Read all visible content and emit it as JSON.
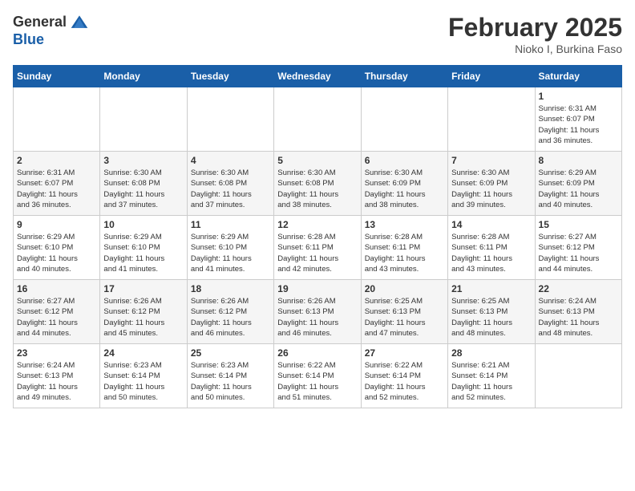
{
  "header": {
    "logo_general": "General",
    "logo_blue": "Blue",
    "month_title": "February 2025",
    "location": "Nioko I, Burkina Faso"
  },
  "days_of_week": [
    "Sunday",
    "Monday",
    "Tuesday",
    "Wednesday",
    "Thursday",
    "Friday",
    "Saturday"
  ],
  "weeks": [
    [
      {
        "day": "",
        "info": ""
      },
      {
        "day": "",
        "info": ""
      },
      {
        "day": "",
        "info": ""
      },
      {
        "day": "",
        "info": ""
      },
      {
        "day": "",
        "info": ""
      },
      {
        "day": "",
        "info": ""
      },
      {
        "day": "1",
        "info": "Sunrise: 6:31 AM\nSunset: 6:07 PM\nDaylight: 11 hours\nand 36 minutes."
      }
    ],
    [
      {
        "day": "2",
        "info": "Sunrise: 6:31 AM\nSunset: 6:07 PM\nDaylight: 11 hours\nand 36 minutes."
      },
      {
        "day": "3",
        "info": "Sunrise: 6:30 AM\nSunset: 6:08 PM\nDaylight: 11 hours\nand 37 minutes."
      },
      {
        "day": "4",
        "info": "Sunrise: 6:30 AM\nSunset: 6:08 PM\nDaylight: 11 hours\nand 37 minutes."
      },
      {
        "day": "5",
        "info": "Sunrise: 6:30 AM\nSunset: 6:08 PM\nDaylight: 11 hours\nand 38 minutes."
      },
      {
        "day": "6",
        "info": "Sunrise: 6:30 AM\nSunset: 6:09 PM\nDaylight: 11 hours\nand 38 minutes."
      },
      {
        "day": "7",
        "info": "Sunrise: 6:30 AM\nSunset: 6:09 PM\nDaylight: 11 hours\nand 39 minutes."
      },
      {
        "day": "8",
        "info": "Sunrise: 6:29 AM\nSunset: 6:09 PM\nDaylight: 11 hours\nand 40 minutes."
      }
    ],
    [
      {
        "day": "9",
        "info": "Sunrise: 6:29 AM\nSunset: 6:10 PM\nDaylight: 11 hours\nand 40 minutes."
      },
      {
        "day": "10",
        "info": "Sunrise: 6:29 AM\nSunset: 6:10 PM\nDaylight: 11 hours\nand 41 minutes."
      },
      {
        "day": "11",
        "info": "Sunrise: 6:29 AM\nSunset: 6:10 PM\nDaylight: 11 hours\nand 41 minutes."
      },
      {
        "day": "12",
        "info": "Sunrise: 6:28 AM\nSunset: 6:11 PM\nDaylight: 11 hours\nand 42 minutes."
      },
      {
        "day": "13",
        "info": "Sunrise: 6:28 AM\nSunset: 6:11 PM\nDaylight: 11 hours\nand 43 minutes."
      },
      {
        "day": "14",
        "info": "Sunrise: 6:28 AM\nSunset: 6:11 PM\nDaylight: 11 hours\nand 43 minutes."
      },
      {
        "day": "15",
        "info": "Sunrise: 6:27 AM\nSunset: 6:12 PM\nDaylight: 11 hours\nand 44 minutes."
      }
    ],
    [
      {
        "day": "16",
        "info": "Sunrise: 6:27 AM\nSunset: 6:12 PM\nDaylight: 11 hours\nand 44 minutes."
      },
      {
        "day": "17",
        "info": "Sunrise: 6:26 AM\nSunset: 6:12 PM\nDaylight: 11 hours\nand 45 minutes."
      },
      {
        "day": "18",
        "info": "Sunrise: 6:26 AM\nSunset: 6:12 PM\nDaylight: 11 hours\nand 46 minutes."
      },
      {
        "day": "19",
        "info": "Sunrise: 6:26 AM\nSunset: 6:13 PM\nDaylight: 11 hours\nand 46 minutes."
      },
      {
        "day": "20",
        "info": "Sunrise: 6:25 AM\nSunset: 6:13 PM\nDaylight: 11 hours\nand 47 minutes."
      },
      {
        "day": "21",
        "info": "Sunrise: 6:25 AM\nSunset: 6:13 PM\nDaylight: 11 hours\nand 48 minutes."
      },
      {
        "day": "22",
        "info": "Sunrise: 6:24 AM\nSunset: 6:13 PM\nDaylight: 11 hours\nand 48 minutes."
      }
    ],
    [
      {
        "day": "23",
        "info": "Sunrise: 6:24 AM\nSunset: 6:13 PM\nDaylight: 11 hours\nand 49 minutes."
      },
      {
        "day": "24",
        "info": "Sunrise: 6:23 AM\nSunset: 6:14 PM\nDaylight: 11 hours\nand 50 minutes."
      },
      {
        "day": "25",
        "info": "Sunrise: 6:23 AM\nSunset: 6:14 PM\nDaylight: 11 hours\nand 50 minutes."
      },
      {
        "day": "26",
        "info": "Sunrise: 6:22 AM\nSunset: 6:14 PM\nDaylight: 11 hours\nand 51 minutes."
      },
      {
        "day": "27",
        "info": "Sunrise: 6:22 AM\nSunset: 6:14 PM\nDaylight: 11 hours\nand 52 minutes."
      },
      {
        "day": "28",
        "info": "Sunrise: 6:21 AM\nSunset: 6:14 PM\nDaylight: 11 hours\nand 52 minutes."
      },
      {
        "day": "",
        "info": ""
      }
    ]
  ]
}
